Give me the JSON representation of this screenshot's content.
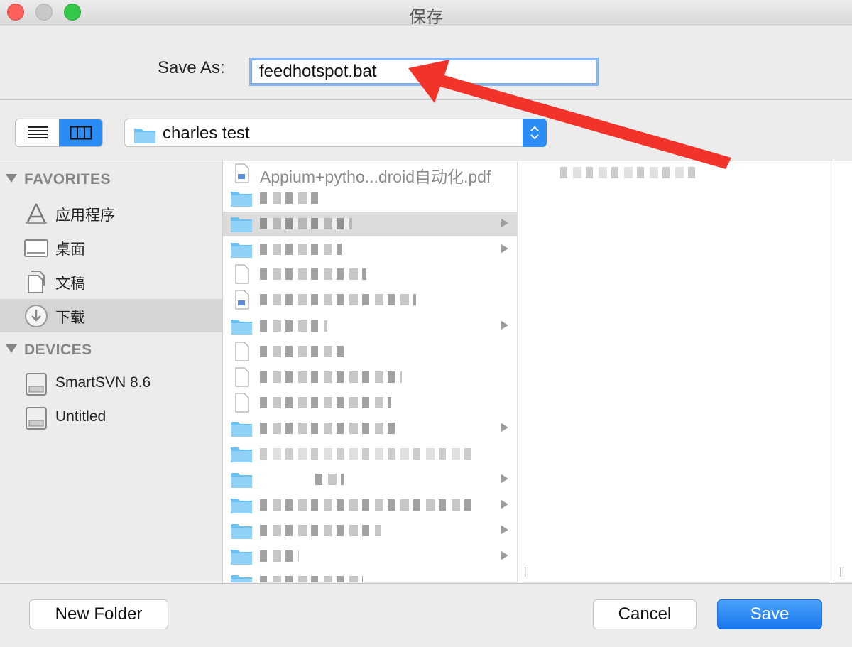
{
  "window": {
    "title": "保存"
  },
  "save_as": {
    "label": "Save As:",
    "value": "feedhotspot.bat"
  },
  "location": {
    "folder": "charles test"
  },
  "sidebar": {
    "favorites_header": "FAVORITES",
    "favorites": [
      {
        "label": "应用程序",
        "icon": "applications-icon"
      },
      {
        "label": "桌面",
        "icon": "desktop-icon"
      },
      {
        "label": "文稿",
        "icon": "documents-icon"
      },
      {
        "label": "下载",
        "icon": "downloads-icon",
        "selected": true
      }
    ],
    "devices_header": "DEVICES",
    "devices": [
      {
        "label": "SmartSVN 8.6",
        "icon": "disk-icon"
      },
      {
        "label": "Untitled",
        "icon": "disk-icon"
      }
    ]
  },
  "files": {
    "first_item": "Appium+pytho...droid自动化.pdf"
  },
  "buttons": {
    "new_folder": "New Folder",
    "cancel": "Cancel",
    "save": "Save"
  },
  "colors": {
    "accent": "#2b8cf6",
    "annotation_arrow": "#f2332a"
  }
}
